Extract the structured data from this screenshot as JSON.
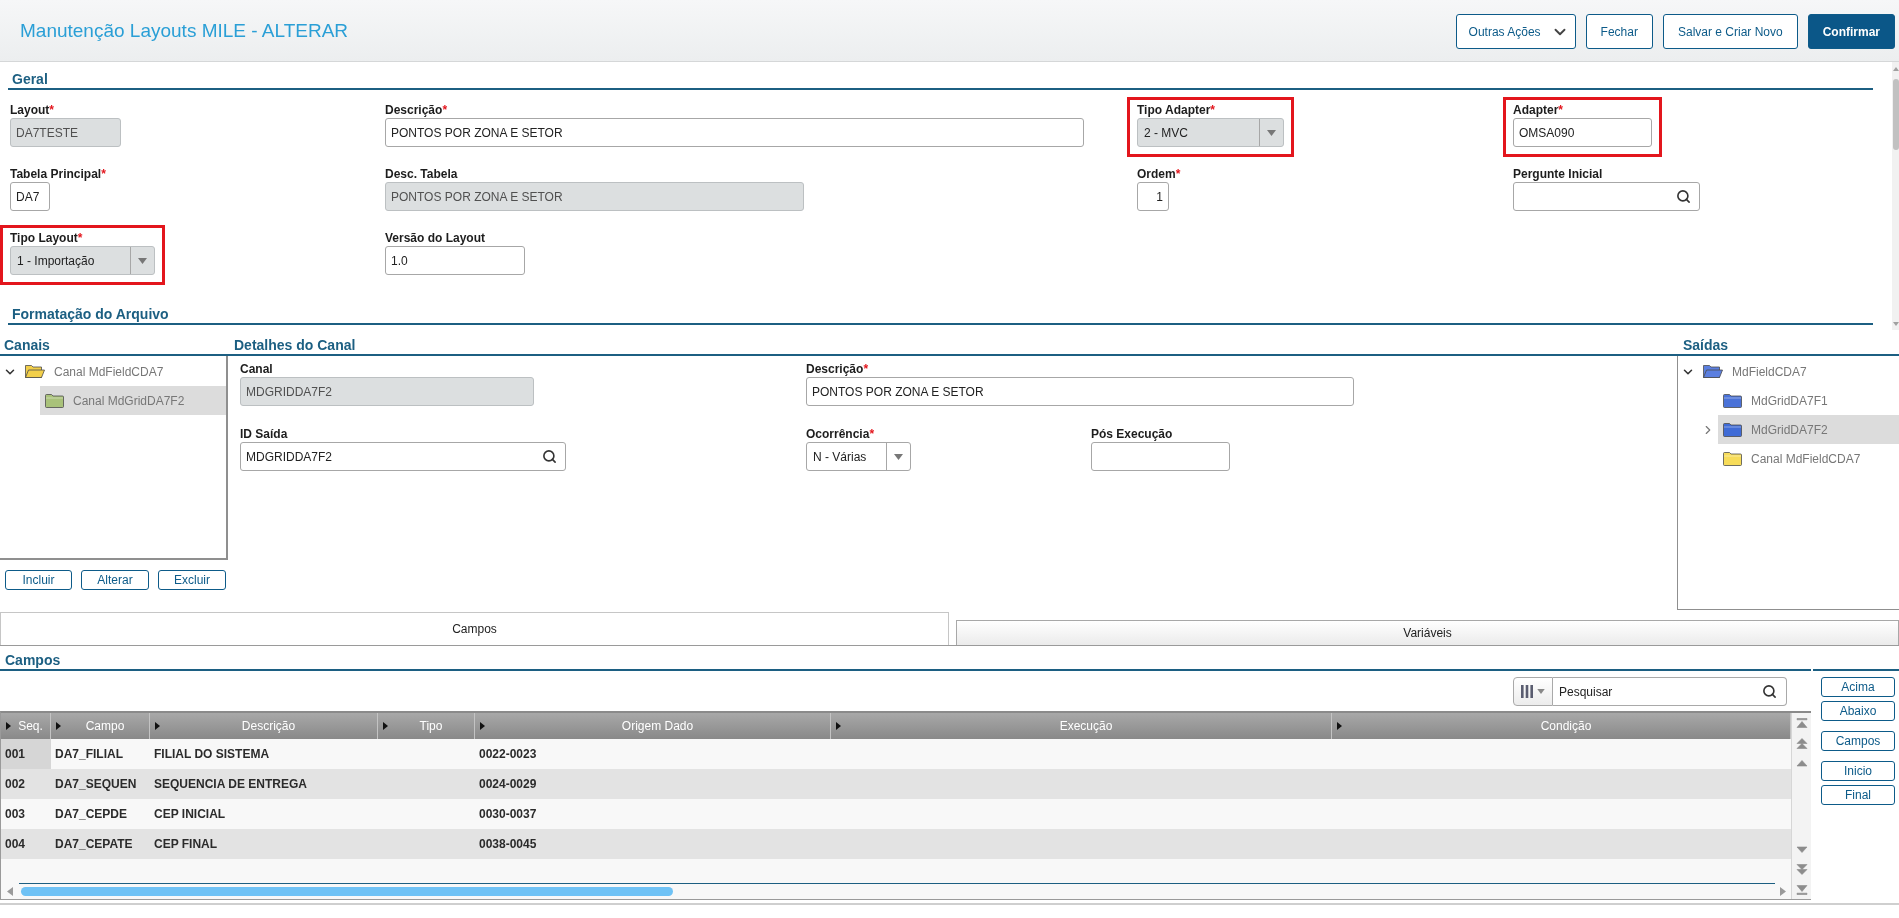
{
  "header": {
    "title": "Manutenção Layouts MILE - ALTERAR",
    "buttons": [
      {
        "label": "Outras Ações",
        "kind": "menu"
      },
      {
        "label": "Fechar",
        "kind": "outline"
      },
      {
        "label": "Salvar e Criar Novo",
        "kind": "outline"
      },
      {
        "label": "Confirmar",
        "kind": "primary"
      }
    ]
  },
  "geral": {
    "title": "Geral",
    "rows": [
      [
        {
          "label": "Layout",
          "required_mark": "*",
          "kind": "text",
          "value": "DA7TESTE",
          "disabled": true,
          "highlighted": false
        },
        {
          "label": "Descrição",
          "required_mark": "*",
          "kind": "text",
          "value": "PONTOS POR ZONA E SETOR",
          "disabled": false,
          "highlighted": false
        },
        {
          "label": "Tipo Adapter",
          "required_mark": "*",
          "kind": "select",
          "value": "2 - MVC",
          "disabled": true,
          "highlighted": true
        },
        {
          "label": "Adapter",
          "required_mark": "*",
          "kind": "text",
          "value": "OMSA090",
          "disabled": false,
          "highlighted": true
        }
      ],
      [
        {
          "label": "Tabela Principal",
          "required_mark": "*",
          "kind": "text",
          "value": "DA7",
          "disabled": false,
          "highlighted": false
        },
        {
          "label": "Desc. Tabela",
          "kind": "text",
          "value": "PONTOS POR ZONA E SETOR",
          "disabled": true,
          "highlighted": false
        },
        {
          "label": "Ordem",
          "required_mark": "*",
          "kind": "number",
          "value": "1",
          "disabled": false,
          "highlighted": false
        },
        {
          "label": "Pergunte Inicial",
          "kind": "lookup",
          "disabled": false,
          "highlighted": false
        }
      ],
      [
        {
          "label": "Tipo Layout",
          "required_mark": "*",
          "kind": "select",
          "value": "1 - Importação",
          "disabled": true,
          "highlighted": true
        },
        {
          "label": "Versão do Layout",
          "kind": "text",
          "value": "1.0",
          "disabled": false,
          "highlighted": false
        }
      ]
    ]
  },
  "formatacao": {
    "title": "Formatação do Arquivo"
  },
  "canais": {
    "title": "Canais",
    "tree": [
      {
        "label": "Canal MdFieldCDA7",
        "color": "#f2cf4a",
        "expandable": true,
        "expanded": true,
        "selected": false,
        "children": [
          {
            "label": "Canal MdGridDA7F2",
            "color": "#a9c27a",
            "expandable": false,
            "expanded": false,
            "selected": true
          }
        ]
      }
    ],
    "buttons": [
      "Incluir",
      "Alterar",
      "Excluir"
    ]
  },
  "detalhes": {
    "title": "Detalhes do Canal",
    "rows": [
      [
        {
          "label": "Canal",
          "kind": "text",
          "value": "MDGRIDDA7F2",
          "disabled": true,
          "highlighted": false
        },
        {
          "label": "Descrição",
          "required_mark": "*",
          "kind": "text",
          "value": "PONTOS POR ZONA E SETOR",
          "disabled": false,
          "highlighted": false
        }
      ],
      [
        {
          "label": "ID Saída",
          "kind": "lookup",
          "value": "MDGRIDDA7F2",
          "disabled": false,
          "highlighted": false
        },
        {
          "label": "Ocorrência",
          "required_mark": "*",
          "kind": "select",
          "value": "N - Várias",
          "disabled": false,
          "highlighted": false
        },
        {
          "label": "Pós Execução",
          "kind": "text",
          "disabled": false,
          "highlighted": false
        }
      ]
    ]
  },
  "saidas": {
    "title": "Saídas",
    "tree": [
      {
        "label": "MdFieldCDA7",
        "color": "#5b7fe0",
        "expandable": true,
        "expanded": true,
        "selected": false,
        "children": [
          {
            "label": "MdGridDA7F1",
            "color": "#4a72d8",
            "expandable": false,
            "expanded": false,
            "selected": false
          },
          {
            "label": "MdGridDA7F2",
            "color": "#3f6bd6",
            "expandable": true,
            "expanded": false,
            "selected": true
          },
          {
            "label": "Canal MdFieldCDA7",
            "color": "#f7dc5a",
            "expandable": false,
            "expanded": false,
            "selected": false
          }
        ]
      }
    ]
  },
  "tabs": [
    {
      "label": "Campos",
      "selected": true
    },
    {
      "label": "Variáveis",
      "selected": false
    }
  ],
  "campos": {
    "title": "Campos",
    "search": {
      "placeholder": "Pesquisar"
    },
    "table": {
      "columns": [
        "Seq.",
        "Campo",
        "Descrição",
        "Tipo",
        "Origem Dado",
        "Execução",
        "Condição"
      ],
      "rows": [
        {
          "cells": [
            "001",
            "DA7_FILIAL",
            "FILIAL DO SISTEMA",
            null,
            "0022-0023",
            null,
            null
          ],
          "selected": true
        },
        {
          "cells": [
            "002",
            "DA7_SEQUEN",
            "SEQUENCIA DE ENTREGA",
            null,
            "0024-0029",
            null,
            null
          ],
          "selected": false
        },
        {
          "cells": [
            "003",
            "DA7_CEPDE",
            "CEP INICIAL",
            null,
            "0030-0037",
            null,
            null
          ],
          "selected": false
        },
        {
          "cells": [
            "004",
            "DA7_CEPATE",
            "CEP FINAL",
            null,
            "0038-0045",
            null,
            null
          ],
          "selected": false
        }
      ]
    },
    "side_buttons": [
      [
        "Acima",
        "Abaixo"
      ],
      [
        "Campos"
      ],
      [
        "Inicio",
        "Final"
      ]
    ]
  }
}
